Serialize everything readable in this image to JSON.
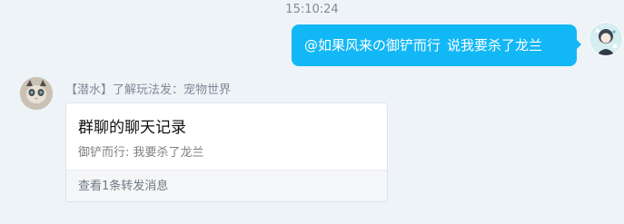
{
  "timestamp": "15:10:24",
  "outgoing": {
    "mention": "@如果风来の御铲而行",
    "text": "说我要杀了龙兰",
    "bubble_color": "#12b7f5"
  },
  "incoming": {
    "sender_tag": "【潜水】",
    "sender_name": "了解玩法发：宠物世界",
    "card": {
      "title": "群聊的聊天记录",
      "lines": [
        "御铲而行: 我要杀了龙兰"
      ],
      "footer": "查看1条转发消息"
    }
  },
  "icons": {
    "self_avatar": "anime-avatar-icon",
    "other_avatar": "cat-avatar-icon"
  }
}
